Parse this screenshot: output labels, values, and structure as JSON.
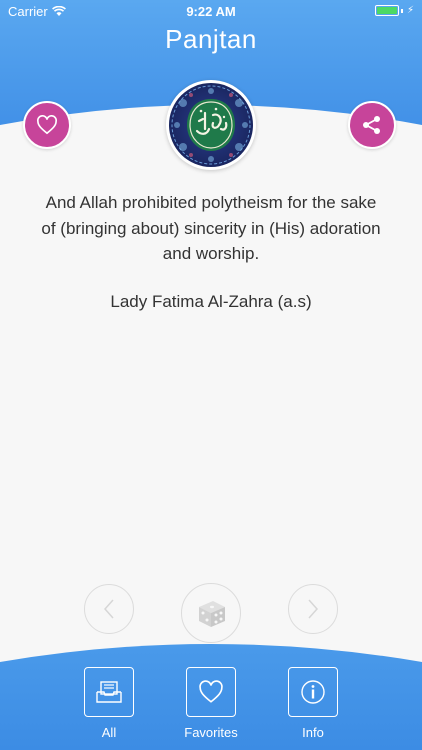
{
  "status_bar": {
    "carrier": "Carrier",
    "time": "9:22 AM"
  },
  "header": {
    "title": "Panjtan"
  },
  "quote": {
    "text": "And Allah prohibited polytheism for the sake of (bringing about) sincerity in (His) adoration and worship.",
    "author": "Lady Fatima Al-Zahra (a.s)"
  },
  "controls": {
    "prev_icon": "chevron-left-icon",
    "random_icon": "dice-icon",
    "next_icon": "chevron-right-icon"
  },
  "tabs": [
    {
      "label": "All",
      "icon": "stack-icon"
    },
    {
      "label": "Favorites",
      "icon": "heart-icon"
    },
    {
      "label": "Info",
      "icon": "info-icon"
    }
  ],
  "colors": {
    "header_blue": "#4a99ea",
    "accent_pink": "#c7449a",
    "background": "#f7f7f7"
  }
}
